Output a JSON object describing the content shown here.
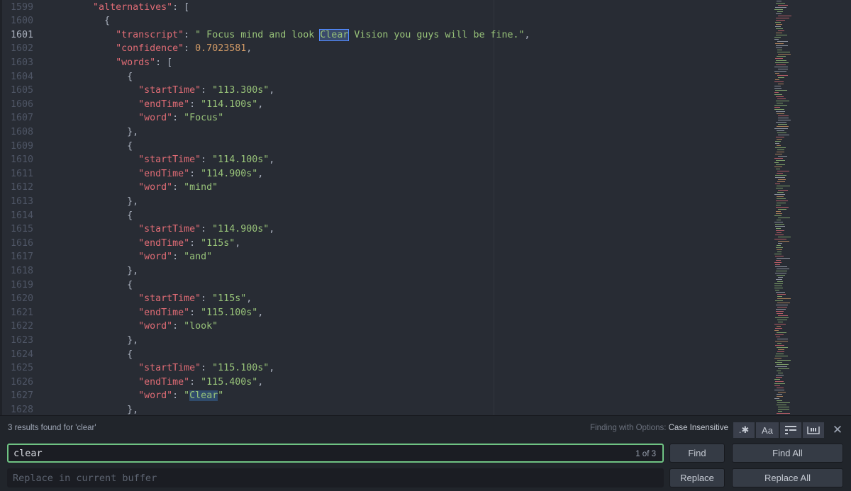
{
  "editor": {
    "current_line": 1601,
    "lines": [
      {
        "num": "1599",
        "t": [
          [
            "        ",
            "p"
          ],
          [
            "\"alternatives\"",
            "k"
          ],
          [
            ": [",
            "p"
          ]
        ]
      },
      {
        "num": "1600",
        "t": [
          [
            "          {",
            "p"
          ]
        ]
      },
      {
        "num": "1601",
        "t": [
          [
            "            ",
            "p"
          ],
          [
            "\"transcript\"",
            "k"
          ],
          [
            ": ",
            "p"
          ],
          [
            "\" Focus mind and look ",
            "s"
          ],
          [
            "Clear",
            "s hl-cur"
          ],
          [
            " Vision you guys will be fine.\"",
            "s"
          ],
          [
            ",",
            "p"
          ]
        ]
      },
      {
        "num": "1602",
        "t": [
          [
            "            ",
            "p"
          ],
          [
            "\"confidence\"",
            "k"
          ],
          [
            ": ",
            "p"
          ],
          [
            "0.7023581",
            "n"
          ],
          [
            ",",
            "p"
          ]
        ]
      },
      {
        "num": "1603",
        "t": [
          [
            "            ",
            "p"
          ],
          [
            "\"words\"",
            "k"
          ],
          [
            ": [",
            "p"
          ]
        ]
      },
      {
        "num": "1604",
        "t": [
          [
            "              {",
            "p"
          ]
        ]
      },
      {
        "num": "1605",
        "t": [
          [
            "                ",
            "p"
          ],
          [
            "\"startTime\"",
            "k"
          ],
          [
            ": ",
            "p"
          ],
          [
            "\"113.300s\"",
            "s"
          ],
          [
            ",",
            "p"
          ]
        ]
      },
      {
        "num": "1606",
        "t": [
          [
            "                ",
            "p"
          ],
          [
            "\"endTime\"",
            "k"
          ],
          [
            ": ",
            "p"
          ],
          [
            "\"114.100s\"",
            "s"
          ],
          [
            ",",
            "p"
          ]
        ]
      },
      {
        "num": "1607",
        "t": [
          [
            "                ",
            "p"
          ],
          [
            "\"word\"",
            "k"
          ],
          [
            ": ",
            "p"
          ],
          [
            "\"Focus\"",
            "s"
          ]
        ]
      },
      {
        "num": "1608",
        "t": [
          [
            "              },",
            "p"
          ]
        ]
      },
      {
        "num": "1609",
        "t": [
          [
            "              {",
            "p"
          ]
        ]
      },
      {
        "num": "1610",
        "t": [
          [
            "                ",
            "p"
          ],
          [
            "\"startTime\"",
            "k"
          ],
          [
            ": ",
            "p"
          ],
          [
            "\"114.100s\"",
            "s"
          ],
          [
            ",",
            "p"
          ]
        ]
      },
      {
        "num": "1611",
        "t": [
          [
            "                ",
            "p"
          ],
          [
            "\"endTime\"",
            "k"
          ],
          [
            ": ",
            "p"
          ],
          [
            "\"114.900s\"",
            "s"
          ],
          [
            ",",
            "p"
          ]
        ]
      },
      {
        "num": "1612",
        "t": [
          [
            "                ",
            "p"
          ],
          [
            "\"word\"",
            "k"
          ],
          [
            ": ",
            "p"
          ],
          [
            "\"mind\"",
            "s"
          ]
        ]
      },
      {
        "num": "1613",
        "t": [
          [
            "              },",
            "p"
          ]
        ]
      },
      {
        "num": "1614",
        "t": [
          [
            "              {",
            "p"
          ]
        ]
      },
      {
        "num": "1615",
        "t": [
          [
            "                ",
            "p"
          ],
          [
            "\"startTime\"",
            "k"
          ],
          [
            ": ",
            "p"
          ],
          [
            "\"114.900s\"",
            "s"
          ],
          [
            ",",
            "p"
          ]
        ]
      },
      {
        "num": "1616",
        "t": [
          [
            "                ",
            "p"
          ],
          [
            "\"endTime\"",
            "k"
          ],
          [
            ": ",
            "p"
          ],
          [
            "\"115s\"",
            "s"
          ],
          [
            ",",
            "p"
          ]
        ]
      },
      {
        "num": "1617",
        "t": [
          [
            "                ",
            "p"
          ],
          [
            "\"word\"",
            "k"
          ],
          [
            ": ",
            "p"
          ],
          [
            "\"and\"",
            "s"
          ]
        ]
      },
      {
        "num": "1618",
        "t": [
          [
            "              },",
            "p"
          ]
        ]
      },
      {
        "num": "1619",
        "t": [
          [
            "              {",
            "p"
          ]
        ]
      },
      {
        "num": "1620",
        "t": [
          [
            "                ",
            "p"
          ],
          [
            "\"startTime\"",
            "k"
          ],
          [
            ": ",
            "p"
          ],
          [
            "\"115s\"",
            "s"
          ],
          [
            ",",
            "p"
          ]
        ]
      },
      {
        "num": "1621",
        "t": [
          [
            "                ",
            "p"
          ],
          [
            "\"endTime\"",
            "k"
          ],
          [
            ": ",
            "p"
          ],
          [
            "\"115.100s\"",
            "s"
          ],
          [
            ",",
            "p"
          ]
        ]
      },
      {
        "num": "1622",
        "t": [
          [
            "                ",
            "p"
          ],
          [
            "\"word\"",
            "k"
          ],
          [
            ": ",
            "p"
          ],
          [
            "\"look\"",
            "s"
          ]
        ]
      },
      {
        "num": "1623",
        "t": [
          [
            "              },",
            "p"
          ]
        ]
      },
      {
        "num": "1624",
        "t": [
          [
            "              {",
            "p"
          ]
        ]
      },
      {
        "num": "1625",
        "t": [
          [
            "                ",
            "p"
          ],
          [
            "\"startTime\"",
            "k"
          ],
          [
            ": ",
            "p"
          ],
          [
            "\"115.100s\"",
            "s"
          ],
          [
            ",",
            "p"
          ]
        ]
      },
      {
        "num": "1626",
        "t": [
          [
            "                ",
            "p"
          ],
          [
            "\"endTime\"",
            "k"
          ],
          [
            ": ",
            "p"
          ],
          [
            "\"115.400s\"",
            "s"
          ],
          [
            ",",
            "p"
          ]
        ]
      },
      {
        "num": "1627",
        "t": [
          [
            "                ",
            "p"
          ],
          [
            "\"word\"",
            "k"
          ],
          [
            ": ",
            "p"
          ],
          [
            "\"",
            "s"
          ],
          [
            "Clear",
            "s hl-match"
          ],
          [
            "\"",
            "s"
          ]
        ]
      },
      {
        "num": "1628",
        "t": [
          [
            "              },",
            "p"
          ]
        ]
      }
    ]
  },
  "find_panel": {
    "results_text": "3 results found for 'clear'",
    "options_label": "Finding with Options:",
    "options_value": "Case Insensitive",
    "option_buttons": [
      {
        "name": "regex-toggle-button",
        "glyph": ".✱"
      },
      {
        "name": "match-case-toggle-button",
        "glyph": "Aa"
      },
      {
        "name": "in-selection-toggle-button",
        "glyph": "☰"
      },
      {
        "name": "whole-word-toggle-button",
        "glyph": "⊔"
      }
    ],
    "close_glyph": "✕",
    "find_value": "clear",
    "find_count": "1 of 3",
    "replace_placeholder": "Replace in current buffer",
    "find_label": "Find",
    "find_all_label": "Find All",
    "replace_label": "Replace",
    "replace_all_label": "Replace All"
  },
  "colors": {
    "background": "#282c34",
    "key": "#e06c75",
    "string": "#98c379",
    "number": "#d19a66",
    "find_border": "#6fc383"
  }
}
